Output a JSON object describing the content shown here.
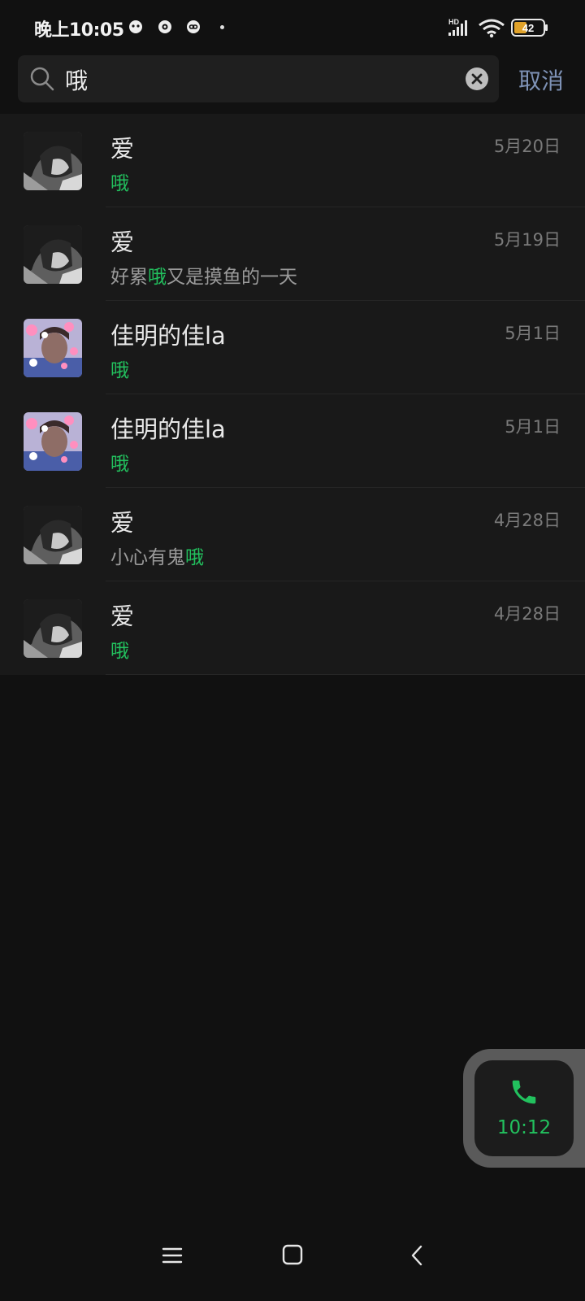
{
  "status_bar": {
    "time": "晚上10:05",
    "battery": "42",
    "network_label": "HD"
  },
  "search": {
    "query": "哦",
    "cancel_label": "取消"
  },
  "results": [
    {
      "name": "爱",
      "date": "5月20日",
      "snippet_before": "",
      "snippet_match": "哦",
      "snippet_after": "",
      "avatar": "dark-portrait"
    },
    {
      "name": "爱",
      "date": "5月19日",
      "snippet_before": "好累",
      "snippet_match": "哦",
      "snippet_after": "又是摸鱼的一天",
      "avatar": "dark-portrait"
    },
    {
      "name": "佳明的佳la",
      "date": "5月1日",
      "snippet_before": "",
      "snippet_match": "哦",
      "snippet_after": "",
      "avatar": "pink-sticker-portrait"
    },
    {
      "name": "佳明的佳la",
      "date": "5月1日",
      "snippet_before": "",
      "snippet_match": "哦",
      "snippet_after": "",
      "avatar": "pink-sticker-portrait"
    },
    {
      "name": "爱",
      "date": "4月28日",
      "snippet_before": "小心有鬼",
      "snippet_match": "哦",
      "snippet_after": "",
      "avatar": "dark-portrait"
    },
    {
      "name": "爱",
      "date": "4月28日",
      "snippet_before": "",
      "snippet_match": "哦",
      "snippet_after": "",
      "avatar": "dark-portrait"
    }
  ],
  "floating_call": {
    "time": "10:12",
    "icon": "phone-icon"
  },
  "colors": {
    "highlight": "#22c15e",
    "background": "#111111",
    "list_background": "#191919",
    "cancel": "#7e92b6"
  }
}
